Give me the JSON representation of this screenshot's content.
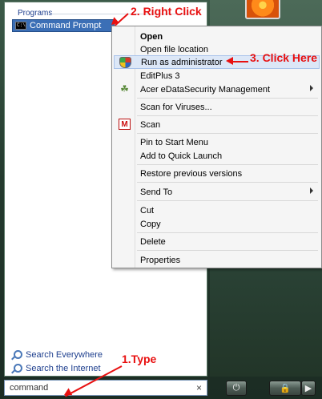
{
  "start_menu": {
    "programs_group_title": "Programs",
    "program_item": "Command Prompt",
    "program_icon_text": "C:\\>",
    "search_links": [
      "Search Everywhere",
      "Search the Internet"
    ],
    "search_value": "command",
    "clear_glyph": "×"
  },
  "power_buttons": {
    "power_glyph": "⏻",
    "lock_glyph": "🔒",
    "arrow_glyph": "▶"
  },
  "context_menu": {
    "items": [
      {
        "label": "Open"
      },
      {
        "label": "Open file location"
      },
      {
        "label": "Run as administrator"
      },
      {
        "label": "EditPlus 3"
      },
      {
        "label": "Acer eDataSecurity Management"
      },
      {
        "label": "Scan for Viruses..."
      },
      {
        "label": "Scan"
      },
      {
        "label": "Pin to Start Menu"
      },
      {
        "label": "Add to Quick Launch"
      },
      {
        "label": "Restore previous versions"
      },
      {
        "label": "Send To"
      },
      {
        "label": "Cut"
      },
      {
        "label": "Copy"
      },
      {
        "label": "Delete"
      },
      {
        "label": "Properties"
      }
    ],
    "mcafee_letter": "M",
    "acer_glyph": "☘"
  },
  "annotations": {
    "step1": "1.Type",
    "step2": "2. Right Click",
    "step3": "3. Click Here"
  },
  "colors": {
    "annotation": "#e81010",
    "highlight": "#dce7f7",
    "selected_program": "#3b6fb6"
  }
}
